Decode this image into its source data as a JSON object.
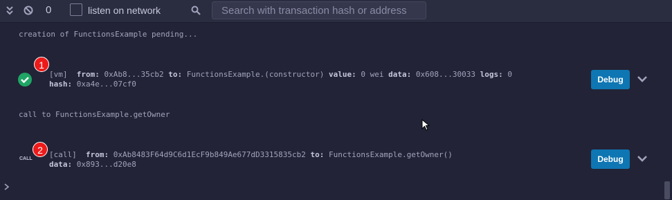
{
  "toolbar": {
    "collapse_icon": "double-chevron-down-icon",
    "clear_icon": "block-icon",
    "pending_count": "0",
    "listen_label": "listen on network",
    "search_icon": "search-icon",
    "search_placeholder": "Search with transaction hash or address"
  },
  "terminal": {
    "line1": "creation of FunctionsExample pending...",
    "tx1": {
      "badge": "1",
      "status_icon": "check-circle-icon",
      "tag": "[vm]",
      "from_label": "from:",
      "from": "0xAb8...35cb2",
      "to_label": "to:",
      "to": "FunctionsExample.(constructor)",
      "value_label": "value:",
      "value": "0 wei",
      "data_label": "data:",
      "data": "0x608...30033",
      "logs_label": "logs:",
      "logs": "0",
      "hash_label": "hash:",
      "hash": "0xa4e...07cf0",
      "debug_label": "Debug"
    },
    "line2": "call to FunctionsExample.getOwner",
    "tx2": {
      "badge": "2",
      "call_icon_label": "CALL",
      "tag": "[call]",
      "from_label": "from:",
      "from": "0xAb8483F64d9C6d1EcF9b849Ae677dD3315835cb2",
      "to_label": "to:",
      "to": "FunctionsExample.getOwner()",
      "data_label": "data:",
      "data": "0x893...d20e8",
      "debug_label": "Debug"
    },
    "prompt_icon": "chevron-right-icon"
  },
  "colors": {
    "background": "#222336",
    "toolbar": "#2a2c3f",
    "debug_button": "#0e76b3",
    "badge": "#ee1a1a",
    "success": "#1fa565"
  }
}
